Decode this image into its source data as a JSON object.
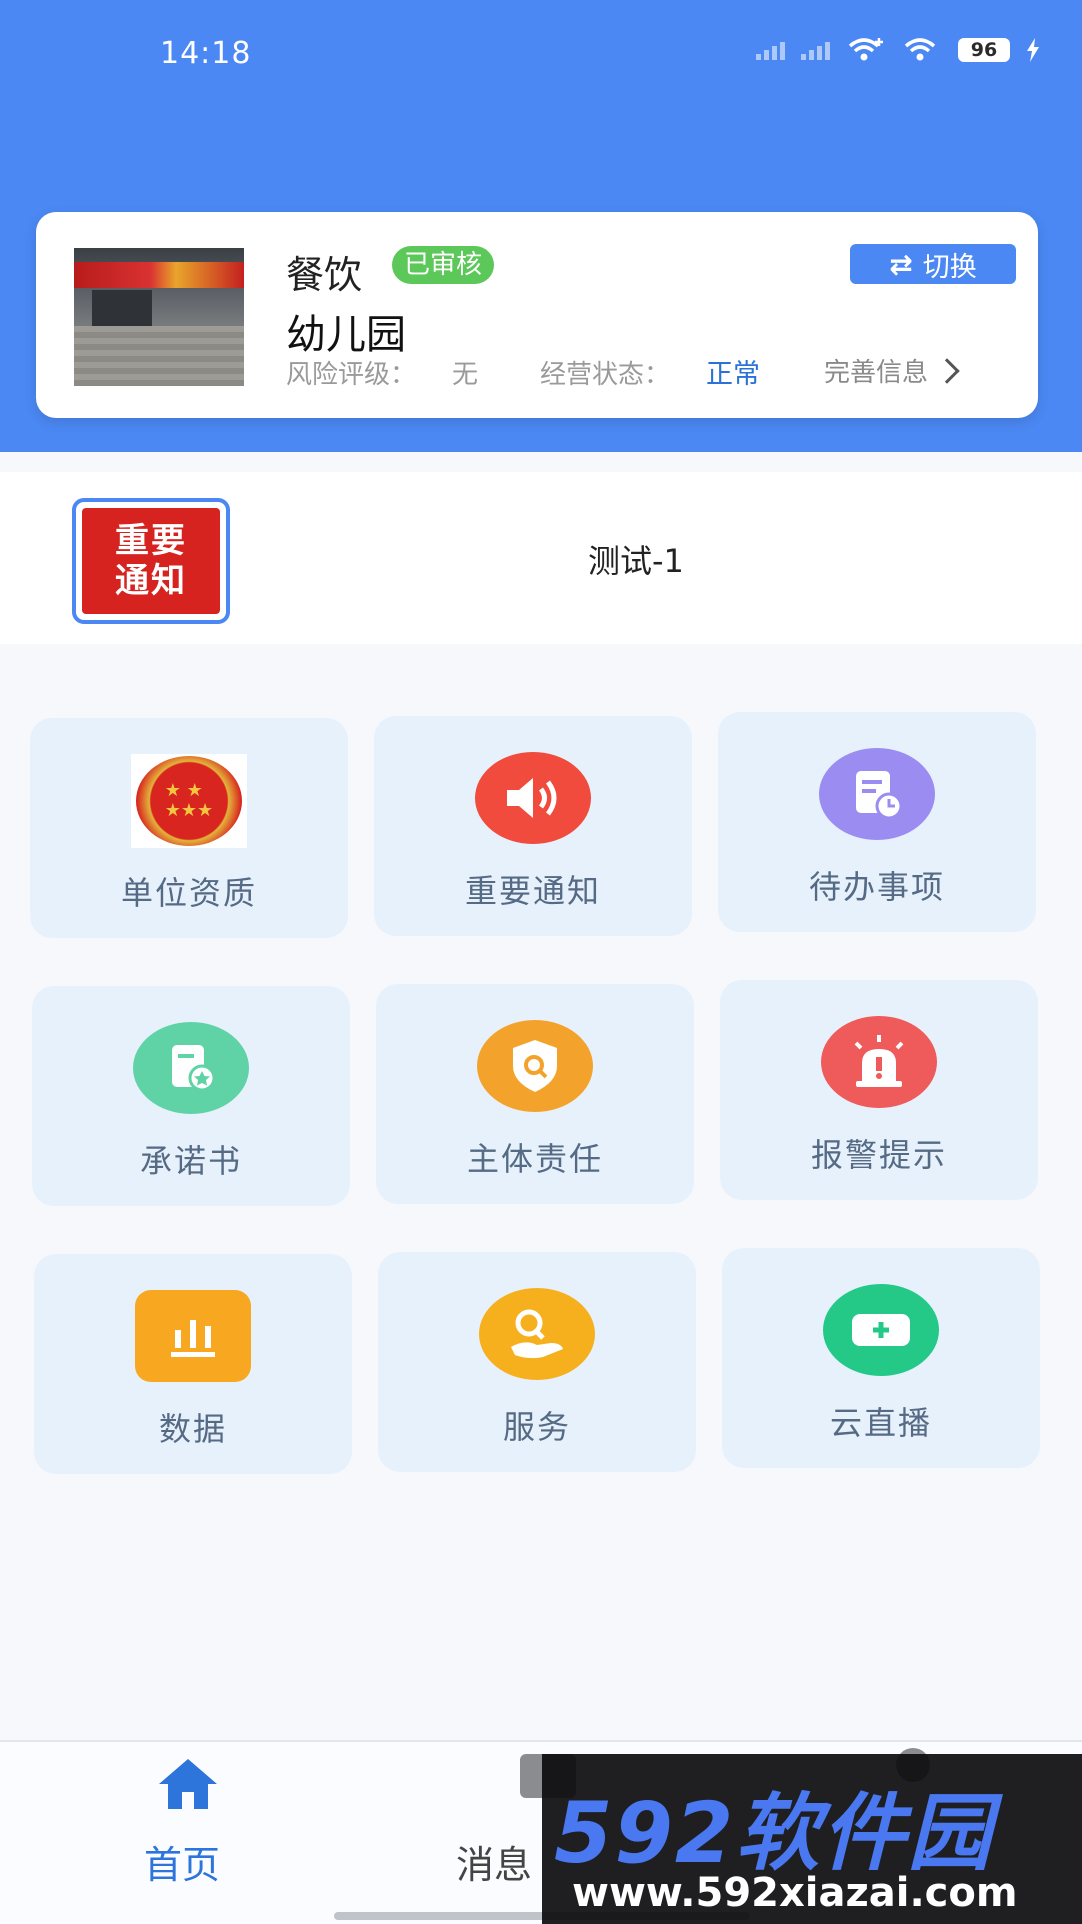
{
  "status_bar": {
    "time": "14:18",
    "battery": "96"
  },
  "store": {
    "category": "餐饮",
    "review_badge": "已审核",
    "name": "幼儿园",
    "risk_label": "风险评级：",
    "risk_value": "无",
    "biz_label": "经营状态：",
    "biz_value": "正常",
    "improve_label": "完善信息",
    "switch_label": "切换"
  },
  "notice": {
    "logo_line1": "重要",
    "logo_line2": "通知",
    "text": "测试-1"
  },
  "grid": [
    {
      "label": "单位资质",
      "icon": "national-emblem-icon",
      "color": "#d8251f"
    },
    {
      "label": "重要通知",
      "icon": "speaker-icon",
      "color": "#f04b3c"
    },
    {
      "label": "待办事项",
      "icon": "todo-list-icon",
      "color": "#9b8cf2"
    },
    {
      "label": "承诺书",
      "icon": "certificate-icon",
      "color": "#5fd3a6"
    },
    {
      "label": "主体责任",
      "icon": "shield-search-icon",
      "color": "#f3a32b"
    },
    {
      "label": "报警提示",
      "icon": "alarm-light-icon",
      "color": "#ef5a5a"
    },
    {
      "label": "数据",
      "icon": "bar-chart-icon",
      "color": "#f7a820"
    },
    {
      "label": "服务",
      "icon": "service-hand-icon",
      "color": "#f6b01e"
    },
    {
      "label": "云直播",
      "icon": "live-camera-icon",
      "color": "#24c887"
    }
  ],
  "bottom_nav": {
    "home": "首页",
    "messages": "消息"
  },
  "watermark": {
    "brand": "592软件园",
    "url": "www.592xiazai.com"
  }
}
